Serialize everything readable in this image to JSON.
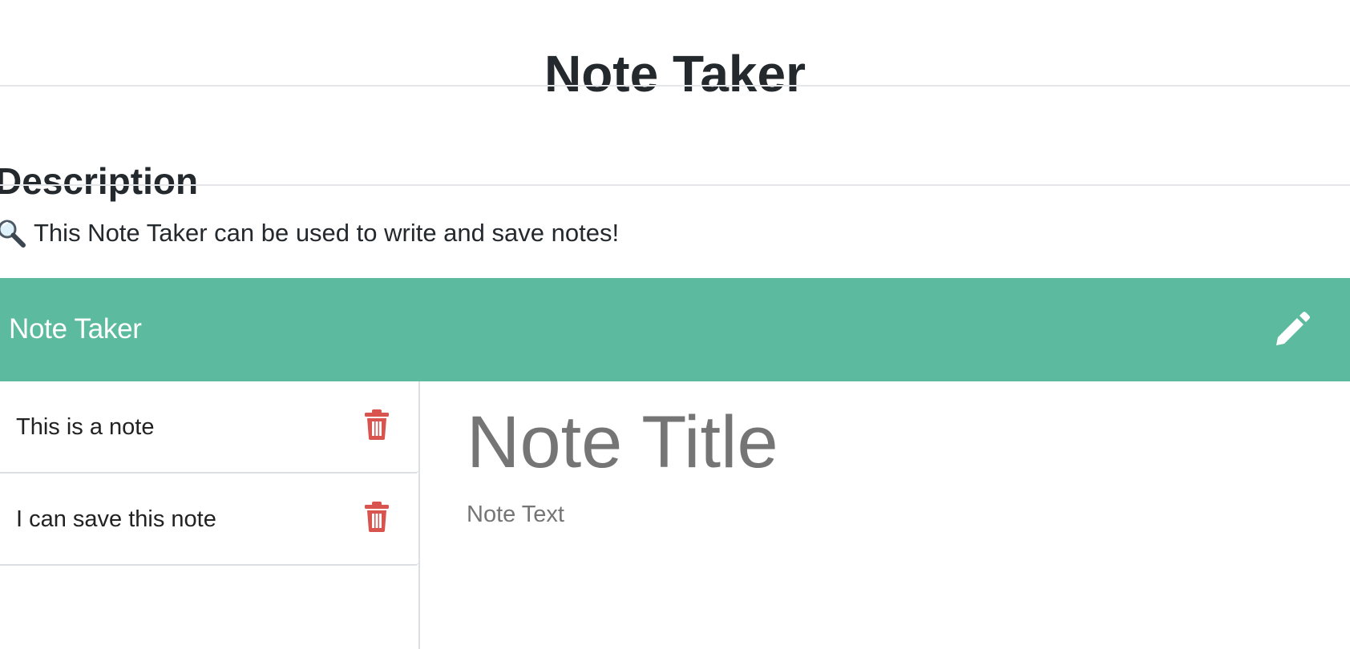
{
  "readme": {
    "title": "Note Taker",
    "section_heading": "Description",
    "description": "This Note Taker can be used to write and save notes!",
    "description_icon": "magnifying-glass-icon"
  },
  "app": {
    "brand": "Note Taker",
    "new_note_icon": "pencil-icon",
    "accent_color": "#5cba9e",
    "delete_color": "#d9534f",
    "notes": [
      {
        "title": "This is a note",
        "delete_icon": "trash-icon"
      },
      {
        "title": "I can save this note",
        "delete_icon": "trash-icon"
      }
    ],
    "editor": {
      "title_placeholder": "Note Title",
      "text_placeholder": "Note Text"
    }
  }
}
